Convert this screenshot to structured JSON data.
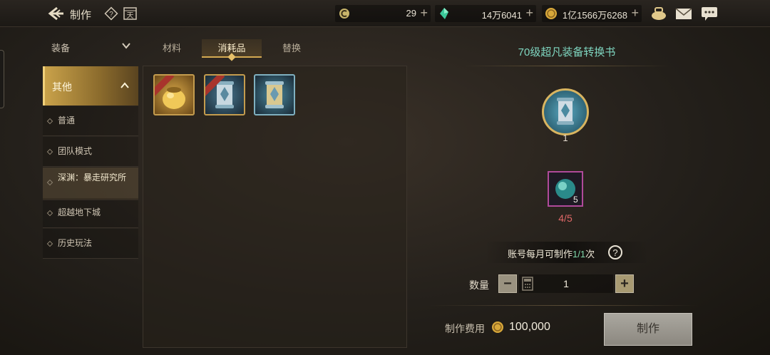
{
  "header": {
    "title": "制作",
    "help_glyph": "?",
    "calendar_glyph": "天"
  },
  "currencies": [
    {
      "icon": "c-coin-icon",
      "value": "29"
    },
    {
      "icon": "green-crystal-icon",
      "value": "14万6041"
    },
    {
      "icon": "gold-coin-icon",
      "value": "1亿1566万6268"
    }
  ],
  "currency_plus": "+",
  "sidebar": {
    "header_label": "装备",
    "active_label": "其他",
    "items": [
      {
        "label": "普通"
      },
      {
        "label": "团队模式"
      },
      {
        "label": "深渊：暴走研究所"
      },
      {
        "label": "超越地下城"
      },
      {
        "label": "历史玩法"
      }
    ]
  },
  "tabs": [
    {
      "label": "材料"
    },
    {
      "label": "消耗品"
    },
    {
      "label": "替换"
    }
  ],
  "recipe": {
    "title": "70级超凡装备转换书",
    "result_qty": "1",
    "material_qty": "5",
    "material_progress": "4/5",
    "monthly_prefix": "账号每月可制作",
    "monthly_count": "1/1",
    "monthly_suffix": "次",
    "quantity_label": "数量",
    "quantity_value": "1",
    "minus": "−",
    "plus": "+",
    "cost_label": "制作费用",
    "cost_value": "100,000",
    "craft_button": "制作"
  },
  "colors": {
    "accent_gold": "#d4aa52",
    "title_teal": "#7fd6c0",
    "progress_red": "#e06868"
  }
}
